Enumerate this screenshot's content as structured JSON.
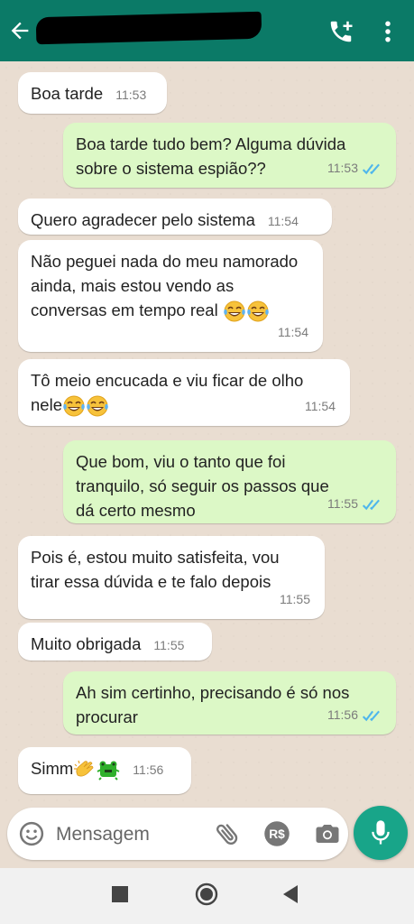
{
  "header": {
    "back_icon": "arrow-left-icon",
    "call_icon": "add-call-icon",
    "menu_icon": "vertical-dots-icon",
    "color": "#0b7a67"
  },
  "messages": [
    {
      "dir": "in",
      "text": "Boa tarde",
      "time": "11:53"
    },
    {
      "dir": "out",
      "text": "Boa tarde tudo bem? Alguma dúvida sobre o sistema espião??",
      "time": "11:53",
      "ticks": "double-blue"
    },
    {
      "dir": "in",
      "text": "Quero agradecer pelo sistema",
      "time": "11:54"
    },
    {
      "dir": "in",
      "text": "Não peguei nada do meu namorado ainda, mais estou vendo as conversas em tempo real",
      "emoji": [
        "face-with-tears-of-joy",
        "face-with-tears-of-joy"
      ],
      "time": "11:54"
    },
    {
      "dir": "in",
      "text": "Tô meio encucada e viu ficar de olho nele",
      "emoji": [
        "face-with-tears-of-joy",
        "face-with-tears-of-joy"
      ],
      "time": "11:54"
    },
    {
      "dir": "out",
      "text": "Que bom, viu o tanto que foi tranquilo, só seguir os passos que dá certo mesmo",
      "time": "11:55",
      "ticks": "double-blue"
    },
    {
      "dir": "in",
      "text": "Pois é, estou muito satisfeita, vou tirar essa dúvida e te falo depois",
      "time": "11:55"
    },
    {
      "dir": "in",
      "text": "Muito obrigada",
      "time": "11:55"
    },
    {
      "dir": "out",
      "text": "Ah sim certinho, precisando é só nos procurar",
      "time": "11:56",
      "ticks": "double-blue"
    },
    {
      "dir": "in",
      "text": "Simm",
      "emoji": [
        "clapping-hands",
        "frog"
      ],
      "time": "11:56"
    }
  ],
  "input": {
    "placeholder": "Mensagem",
    "icons": [
      "emoji-icon",
      "attach-icon",
      "payment-icon",
      "camera-icon"
    ]
  },
  "mic_icon": "microphone-icon",
  "colors": {
    "incoming_bubble": "#ffffff",
    "outgoing_bubble": "#dcf8c6",
    "chat_background": "#e9ddd1",
    "read_ticks": "#4fb6ec",
    "accent": "#18a589"
  },
  "navbar": [
    "recents-icon",
    "home-icon",
    "back-icon"
  ]
}
